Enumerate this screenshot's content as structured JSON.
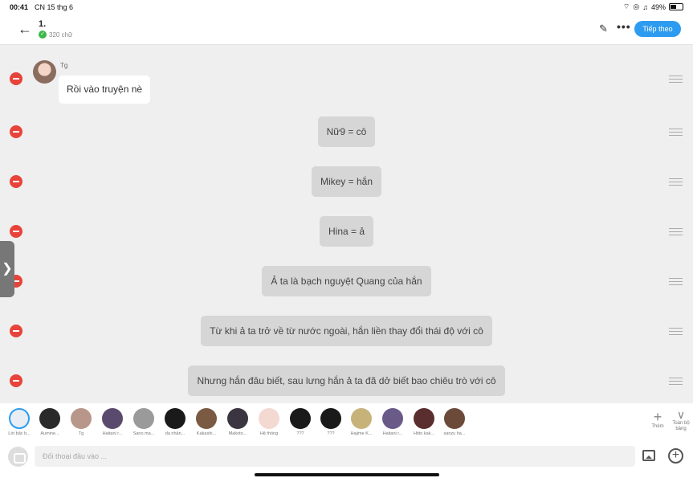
{
  "status": {
    "time": "00:41",
    "date": "CN 15 thg 6",
    "battery": "49%"
  },
  "header": {
    "title": "1.",
    "word_count": "320 chữ",
    "next_label": "Tiếp theo"
  },
  "messages": [
    {
      "speaker": "Tg",
      "text": "Rồi vào truyện nè"
    },
    {
      "text": "Nữ9 = cô"
    },
    {
      "text": "Mikey = hắn"
    },
    {
      "text": "Hina = ả"
    },
    {
      "text": "Ả ta là bạch nguyệt Quang của hắn"
    },
    {
      "text": "Từ khi ả ta trở về từ nước ngoài, hắn liền thay đổi thái độ với cô"
    },
    {
      "text": "Nhưng hắn đâu biết, sau lưng hắn ả ta đã dở biết bao chiêu trò với cô"
    }
  ],
  "characters": [
    {
      "name": "Lời bắc b...",
      "color": "#e9eef5"
    },
    {
      "name": "Aumine...",
      "color": "#2a2a2a"
    },
    {
      "name": "Tg",
      "color": "#b8978a"
    },
    {
      "name": "Haitani r...",
      "color": "#5a4b6e"
    },
    {
      "name": "Sano ma...",
      "color": "#9a9a9a"
    },
    {
      "name": "da nhân...",
      "color": "#1a1a1a"
    },
    {
      "name": "Kakashi...",
      "color": "#7a5a42"
    },
    {
      "name": "Makoto...",
      "color": "#3a3540"
    },
    {
      "name": "Hệ thống",
      "color": "#f3d9d2"
    },
    {
      "name": "???",
      "color": "#1a1a1a"
    },
    {
      "name": "???",
      "color": "#1a1a1a"
    },
    {
      "name": "Hajime K...",
      "color": "#c7b37a"
    },
    {
      "name": "Haitani r...",
      "color": "#6a5a88"
    },
    {
      "name": "Hitto kak...",
      "color": "#5a2e2e"
    },
    {
      "name": "sanzu ha...",
      "color": "#6b4a3a"
    }
  ],
  "toolbar": {
    "more_label": "Thêm",
    "fullscreen_label": "Toàn bộ bảng"
  },
  "input": {
    "placeholder": "Đối thoại đầu vào ..."
  }
}
